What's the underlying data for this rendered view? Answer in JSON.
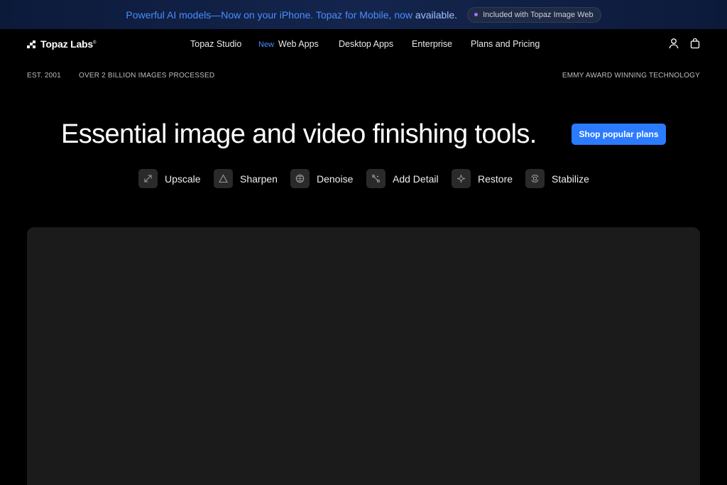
{
  "banner": {
    "message": "Powerful AI models—Now on your iPhone. Topaz for Mobile, now",
    "message_suffix": "available.",
    "pill_label": "Included with Topaz Image Web"
  },
  "nav": {
    "brand": "Topaz Labs",
    "brand_mark": "®",
    "links": [
      {
        "label": "Topaz Studio"
      },
      {
        "badge": "New",
        "label": "Web Apps"
      },
      {
        "label": "Desktop Apps"
      },
      {
        "label": "Enterprise"
      },
      {
        "label": "Plans and Pricing"
      }
    ],
    "icons": [
      "account-icon",
      "cart-icon"
    ]
  },
  "taglines": {
    "established": "EST. 2001",
    "processed": "OVER 2 BILLION IMAGES PROCESSED",
    "award": "EMMY AWARD WINNING TECHNOLOGY"
  },
  "hero": {
    "title": "Essential image and video finishing tools.",
    "cta_label": "Shop popular plans"
  },
  "tools": [
    {
      "label": "Upscale",
      "icon": "upscale-icon"
    },
    {
      "label": "Sharpen",
      "icon": "sharpen-icon"
    },
    {
      "label": "Denoise",
      "icon": "denoise-icon"
    },
    {
      "label": "Add Detail",
      "icon": "add-detail-icon"
    },
    {
      "label": "Restore",
      "icon": "restore-icon"
    },
    {
      "label": "Stabilize",
      "icon": "stabilize-icon"
    }
  ],
  "colors": {
    "accent": "#2b7bff",
    "banner_text": "#4b8dff",
    "background": "#000000",
    "panel": "#1b1b1b"
  }
}
